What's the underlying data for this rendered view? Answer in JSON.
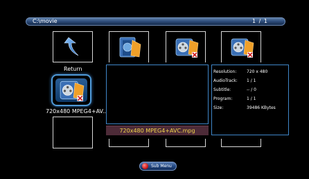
{
  "path_bar": {
    "path": "C:\\movie",
    "page": "1 / 1"
  },
  "tiles": {
    "return_label": "Return",
    "selected_label": "720x480 MPEG4+AV.."
  },
  "preview": {
    "filename": "720x480 MPEG4+AVC.mpg"
  },
  "info": {
    "rows": [
      {
        "label": "Resolution:",
        "value": "720 x 480"
      },
      {
        "label": "AudioTrack:",
        "value": "1 / 1"
      },
      {
        "label": "Subtitle:",
        "value": "-- / 0"
      },
      {
        "label": "Program:",
        "value": "1 / 1"
      },
      {
        "label": "Size:",
        "value": "39486 KBytes"
      }
    ]
  },
  "sub_menu": {
    "label": "Sub Menu"
  },
  "icons": {
    "return": "return-arrow-icon",
    "folder": "folder-icon",
    "movie": "movie-file-icon",
    "submenu": "red-button-icon"
  },
  "colors": {
    "accent": "#3f86c8",
    "filename_text": "#f0d44a",
    "filename_bg": "#4d2b38"
  }
}
